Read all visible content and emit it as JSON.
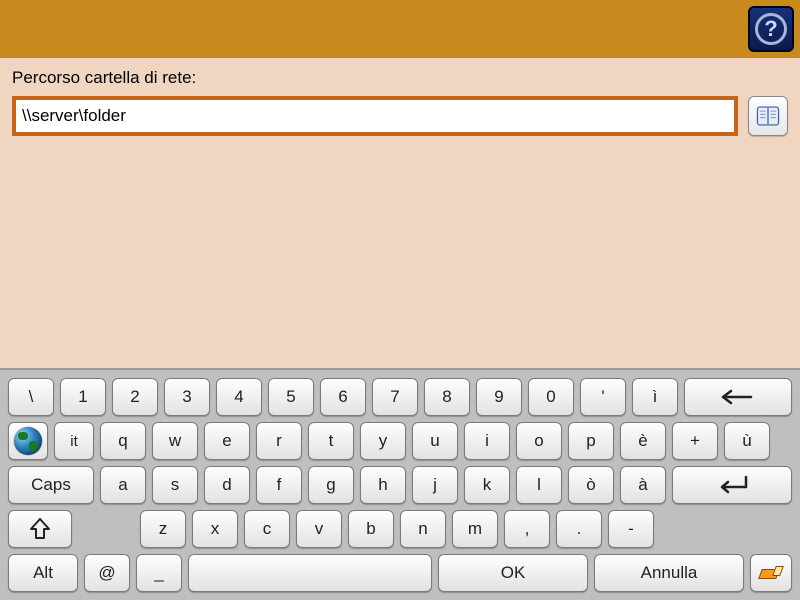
{
  "header": {
    "help_tooltip": "?"
  },
  "field": {
    "label": "Percorso cartella di rete:",
    "value": "\\\\server\\folder"
  },
  "keyboard": {
    "row1": [
      "\\",
      "1",
      "2",
      "3",
      "4",
      "5",
      "6",
      "7",
      "8",
      "9",
      "0",
      "'",
      "ì"
    ],
    "row2_lang": "it",
    "row2": [
      "q",
      "w",
      "e",
      "r",
      "t",
      "y",
      "u",
      "i",
      "o",
      "p",
      "è",
      "+",
      "ù"
    ],
    "caps": "Caps",
    "row3": [
      "a",
      "s",
      "d",
      "f",
      "g",
      "h",
      "j",
      "k",
      "l",
      "ò",
      "à"
    ],
    "row4": [
      "z",
      "x",
      "c",
      "v",
      "b",
      "n",
      "m",
      ",",
      ".",
      "-"
    ],
    "alt": "Alt",
    "at": "@",
    "underscore": "_",
    "ok": "OK",
    "cancel": "Annulla"
  }
}
